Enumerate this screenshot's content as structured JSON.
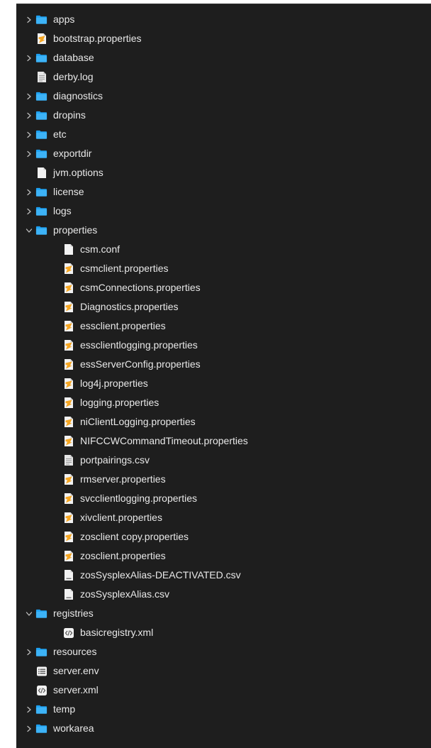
{
  "colors": {
    "background": "#1e1e1e",
    "text": "#e8e8e8",
    "folder": "#1da1f2",
    "properties_icon": "#f5a623"
  },
  "tree": [
    {
      "name": "apps",
      "type": "folder",
      "expanded": false,
      "depth": 0
    },
    {
      "name": "bootstrap.properties",
      "type": "properties",
      "depth": 0
    },
    {
      "name": "database",
      "type": "folder",
      "expanded": false,
      "depth": 0
    },
    {
      "name": "derby.log",
      "type": "text",
      "depth": 0
    },
    {
      "name": "diagnostics",
      "type": "folder",
      "expanded": false,
      "depth": 0
    },
    {
      "name": "dropins",
      "type": "folder",
      "expanded": false,
      "depth": 0
    },
    {
      "name": "etc",
      "type": "folder",
      "expanded": false,
      "depth": 0
    },
    {
      "name": "exportdir",
      "type": "folder",
      "expanded": false,
      "depth": 0
    },
    {
      "name": "jvm.options",
      "type": "blank",
      "depth": 0
    },
    {
      "name": "license",
      "type": "folder",
      "expanded": false,
      "depth": 0
    },
    {
      "name": "logs",
      "type": "folder",
      "expanded": false,
      "depth": 0
    },
    {
      "name": "properties",
      "type": "folder",
      "expanded": true,
      "depth": 0
    },
    {
      "name": "csm.conf",
      "type": "blank",
      "depth": 1
    },
    {
      "name": "csmclient.properties",
      "type": "properties",
      "depth": 1
    },
    {
      "name": "csmConnections.properties",
      "type": "properties",
      "depth": 1
    },
    {
      "name": "Diagnostics.properties",
      "type": "properties",
      "depth": 1
    },
    {
      "name": "essclient.properties",
      "type": "properties",
      "depth": 1
    },
    {
      "name": "essclientlogging.properties",
      "type": "properties",
      "depth": 1
    },
    {
      "name": "essServerConfig.properties",
      "type": "properties",
      "depth": 1
    },
    {
      "name": "log4j.properties",
      "type": "properties",
      "depth": 1
    },
    {
      "name": "logging.properties",
      "type": "properties",
      "depth": 1
    },
    {
      "name": "niClientLogging.properties",
      "type": "properties",
      "depth": 1
    },
    {
      "name": "NIFCCWCommandTimeout.properties",
      "type": "properties",
      "depth": 1
    },
    {
      "name": "portpairings.csv",
      "type": "text",
      "depth": 1
    },
    {
      "name": "rmserver.properties",
      "type": "properties",
      "depth": 1
    },
    {
      "name": "svcclientlogging.properties",
      "type": "properties",
      "depth": 1
    },
    {
      "name": "xivclient.properties",
      "type": "properties",
      "depth": 1
    },
    {
      "name": "zosclient copy.properties",
      "type": "properties",
      "depth": 1
    },
    {
      "name": "zosclient.properties",
      "type": "properties",
      "depth": 1
    },
    {
      "name": "zosSysplexAlias-DEACTIVATED.csv",
      "type": "csv",
      "depth": 1
    },
    {
      "name": "zosSysplexAlias.csv",
      "type": "csv",
      "depth": 1
    },
    {
      "name": "registries",
      "type": "folder",
      "expanded": true,
      "depth": 0
    },
    {
      "name": "basicregistry.xml",
      "type": "xml",
      "depth": 1
    },
    {
      "name": "resources",
      "type": "folder",
      "expanded": false,
      "depth": 0
    },
    {
      "name": "server.env",
      "type": "env",
      "depth": 0
    },
    {
      "name": "server.xml",
      "type": "xml",
      "depth": 0
    },
    {
      "name": "temp",
      "type": "folder",
      "expanded": false,
      "depth": 0
    },
    {
      "name": "workarea",
      "type": "folder",
      "expanded": false,
      "depth": 0
    }
  ]
}
